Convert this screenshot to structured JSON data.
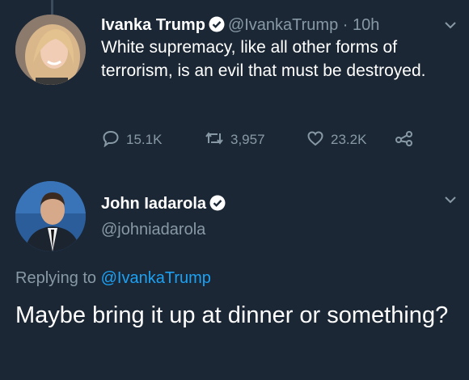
{
  "tweet1": {
    "name": "Ivanka Trump",
    "handle": "@IvankaTrump",
    "separator": "·",
    "time": "10h",
    "text": "White supremacy, like all other forms of terrorism, is an evil that must be destroyed.",
    "replies": "15.1K",
    "retweets": "3,957",
    "likes": "23.2K"
  },
  "tweet2": {
    "name": "John Iadarola",
    "handle": "@johniadarola",
    "replying_prefix": "Replying to",
    "replying_handle": "@IvankaTrump",
    "text": "Maybe bring it up at dinner or something?"
  },
  "colors": {
    "background": "#1b2735",
    "muted": "#8899a6",
    "link": "#1da1f2",
    "text": "#ffffff"
  },
  "icons": [
    "verified-badge-icon",
    "chevron-down-icon",
    "reply-icon",
    "retweet-icon",
    "like-icon",
    "share-icon"
  ]
}
